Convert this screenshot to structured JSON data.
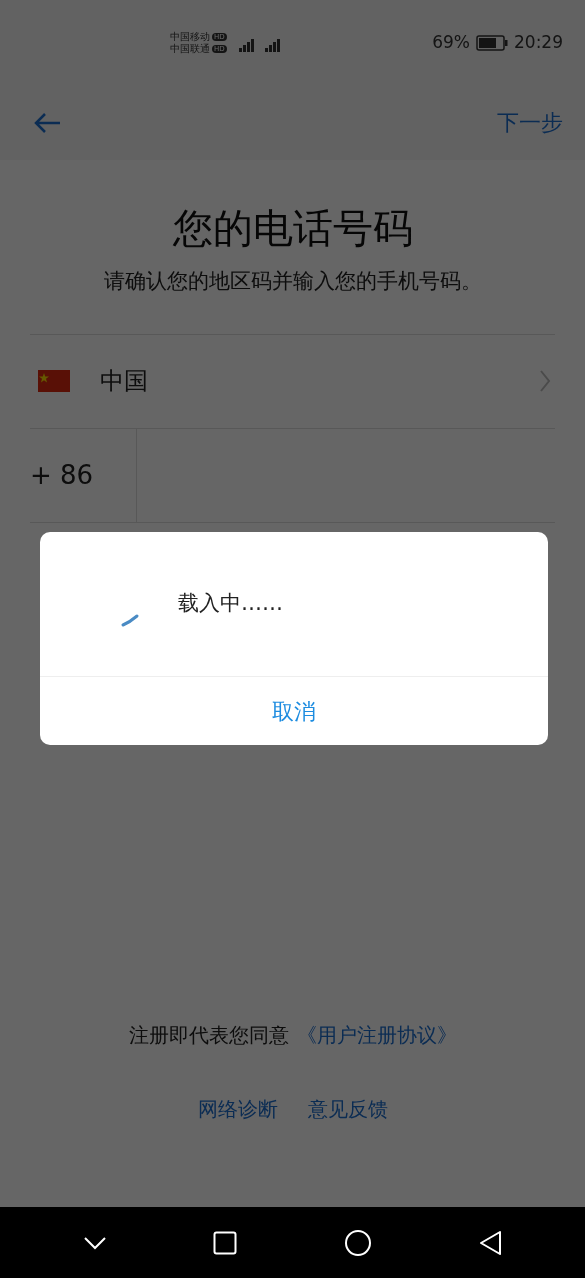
{
  "status_bar": {
    "carriers": [
      {
        "name": "中国移动",
        "badge": "HD"
      },
      {
        "name": "中国联通",
        "badge": "HD"
      }
    ],
    "battery": "69%",
    "time": "20:29"
  },
  "top_bar": {
    "next": "下一步"
  },
  "title": "您的电话号码",
  "subtitle": "请确认您的地区码并输入您的手机号码。",
  "country": {
    "name": "中国"
  },
  "phone": {
    "code": "+ 86"
  },
  "agreement": {
    "text": "注册即代表您同意",
    "link": "《用户注册协议》"
  },
  "links": [
    "网络诊断",
    "意见反馈"
  ],
  "dialog": {
    "message": "载入中……",
    "cancel": "取消"
  }
}
